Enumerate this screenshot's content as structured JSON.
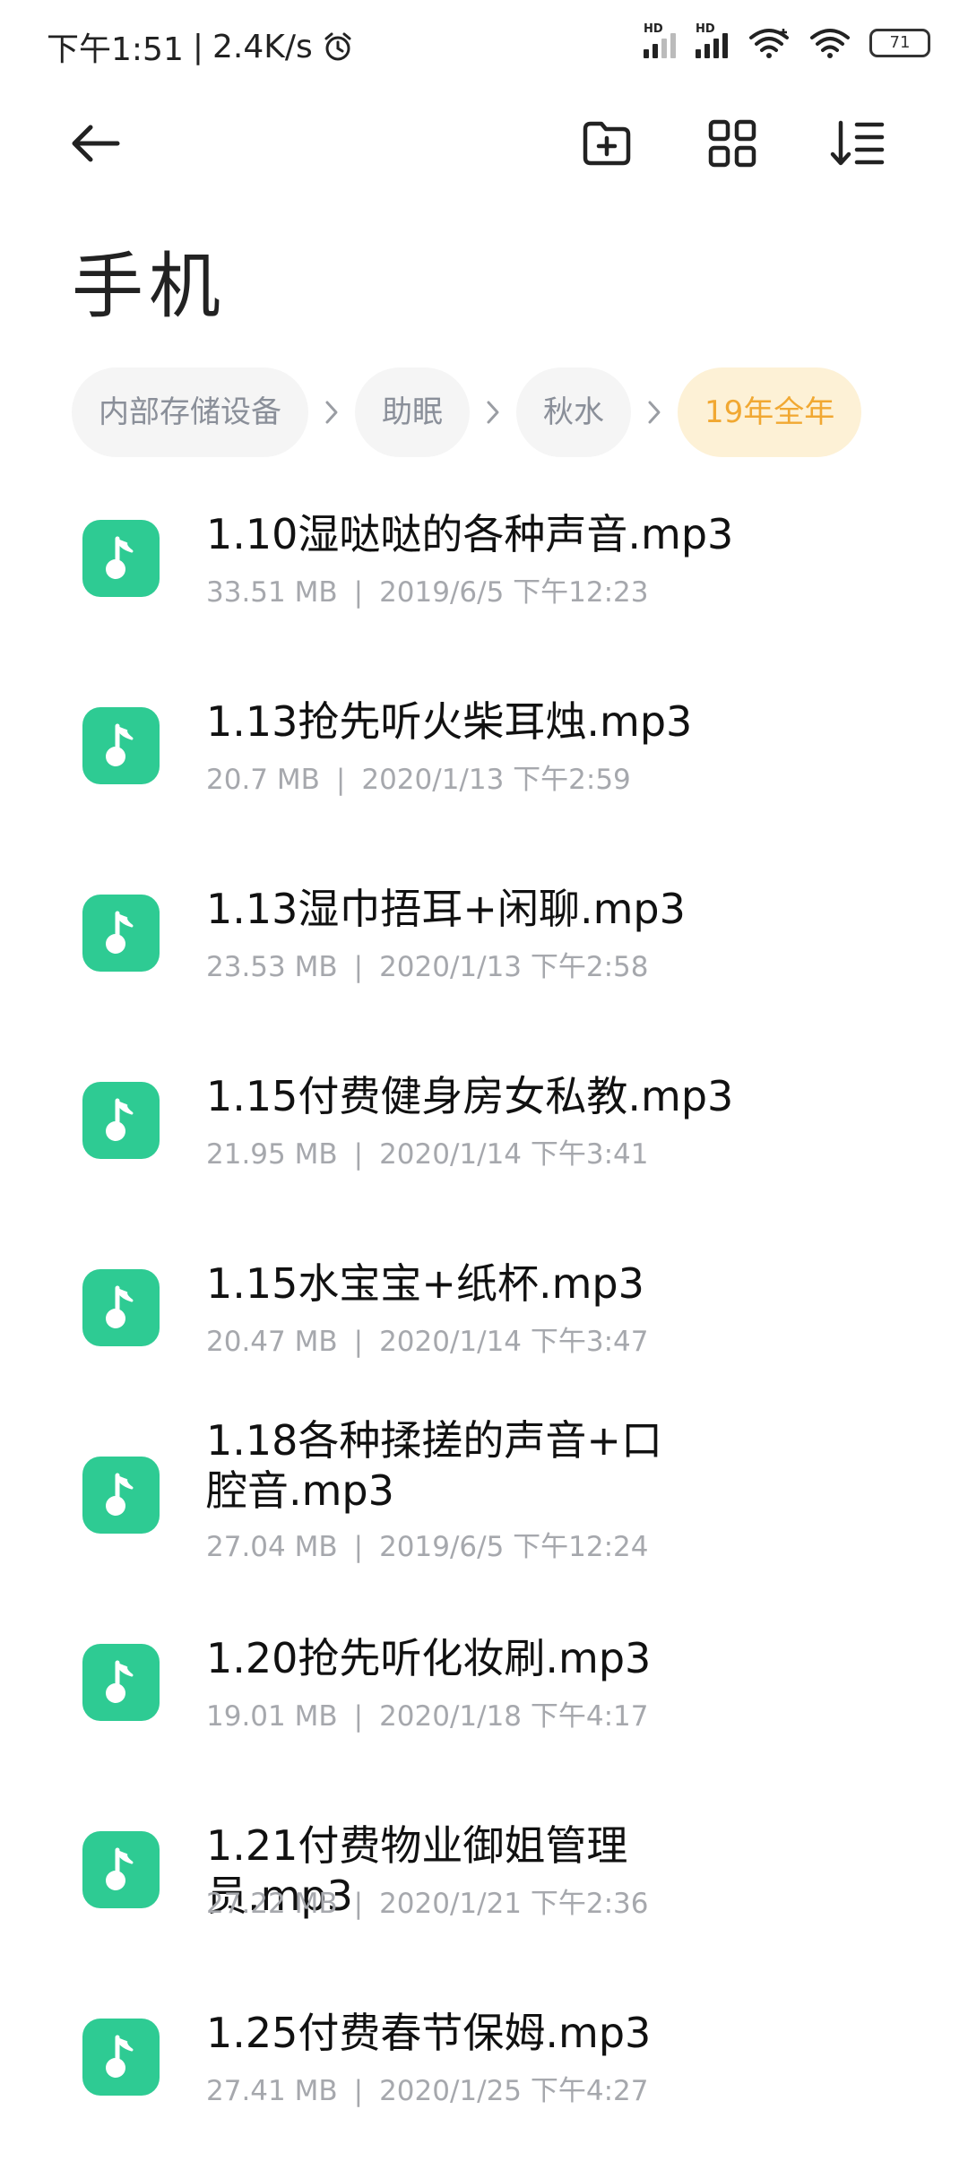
{
  "status_bar": {
    "time": "下午1:51",
    "speed": "2.4K/s",
    "battery": "71",
    "hd_label": "HD"
  },
  "toolbar": {
    "back_icon": "arrow-left-icon",
    "new_folder_icon": "folder-plus-icon",
    "grid_icon": "grid-view-icon",
    "sort_icon": "sort-icon"
  },
  "title": "手机",
  "breadcrumb": [
    {
      "label": "内部存储设备",
      "active": false
    },
    {
      "label": "助眠",
      "active": false
    },
    {
      "label": "秋水",
      "active": false
    },
    {
      "label": "19年全年",
      "active": true
    }
  ],
  "files": [
    {
      "name": "1.10湿哒哒的各种声音.mp3",
      "size": "33.51 MB",
      "date": "2019/6/5 下午12:23"
    },
    {
      "name": "1.13抢先听火柴耳烛.mp3",
      "size": "20.7 MB",
      "date": "2020/1/13 下午2:59"
    },
    {
      "name": "1.13湿巾捂耳+闲聊.mp3",
      "size": "23.53 MB",
      "date": "2020/1/13 下午2:58"
    },
    {
      "name": "1.15付费健身房女私教.mp3",
      "size": "21.95 MB",
      "date": "2020/1/14 下午3:41"
    },
    {
      "name": "1.15水宝宝+纸杯.mp3",
      "size": "20.47 MB",
      "date": "2020/1/14 下午3:47"
    },
    {
      "name": "1.18各种揉搓的声音+口腔音.mp3",
      "size": "27.04 MB",
      "date": "2019/6/5 下午12:24"
    },
    {
      "name": "1.20抢先听化妆刷.mp3",
      "size": "19.01 MB",
      "date": "2020/1/18 下午4:17"
    },
    {
      "name": "1.21付费物业御姐管理员.mp3",
      "size": "27.22 MB",
      "date": "2020/1/21 下午2:36"
    },
    {
      "name": "1.25付费春节保姆.mp3",
      "size": "27.41 MB",
      "date": "2020/1/25 下午4:27"
    }
  ],
  "meta_separator": "|",
  "colors": {
    "accent": "#f1a832",
    "accent_bg": "#fdf1d6",
    "file_icon": "#2ecb93"
  }
}
